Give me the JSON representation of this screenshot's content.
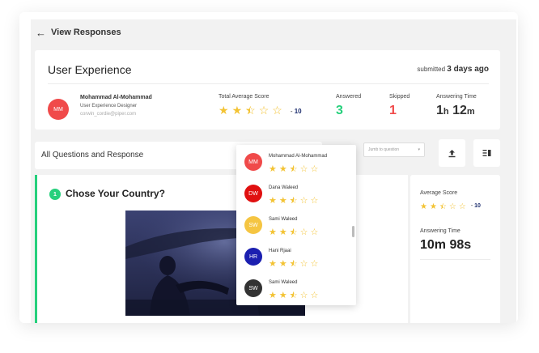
{
  "header": {
    "back_icon": "arrow-left-icon",
    "title": "View Responses"
  },
  "response": {
    "title": "User Experience",
    "submitted_label": "submitted",
    "submitted_value": "3 days ago",
    "user": {
      "initials": "MM",
      "avatar_color": "#f04a4a",
      "name": "Mohammad Al-Mohammad",
      "role": "User Experience Designer",
      "email": "corwin_cordie@piper.com"
    },
    "total_score": {
      "label": "Total Average Score",
      "stars": 2.5,
      "max": 5,
      "separator": "-",
      "value": "10"
    },
    "answered": {
      "label": "Answered",
      "value": "3",
      "color": "#26d07c"
    },
    "skipped": {
      "label": "Skipped",
      "value": "1",
      "color": "#f04a4a"
    },
    "answering_time": {
      "label": "Answering Time",
      "hours": "1",
      "hours_unit": "h",
      "minutes": "12",
      "minutes_unit": "m"
    }
  },
  "questions_bar": {
    "title": "All Questions and Response",
    "jump_placeholder": "Jumb to question",
    "upload_icon": "upload-icon",
    "layout_icon": "column-layout-icon"
  },
  "question": {
    "number": "1",
    "title": "Chose Your Country?",
    "average_label": "Average Score",
    "average_stars": 2.5,
    "average_value": "10",
    "time_label": "Answering Time",
    "time_value": "10m 98s"
  },
  "respondents": [
    {
      "initials": "MM",
      "name": "Mohammad Al-Mohammad",
      "color": "#f04a4a",
      "stars": 2.5
    },
    {
      "initials": "DW",
      "name": "Dana Waleed",
      "color": "#e01010",
      "stars": 2.5
    },
    {
      "initials": "SW",
      "name": "Sami Waleed",
      "color": "#f5c542",
      "stars": 2.5
    },
    {
      "initials": "HR",
      "name": "Hani Rjaai",
      "color": "#1b1fb0",
      "stars": 2.5
    },
    {
      "initials": "SW",
      "name": "Sami Waleed",
      "color": "#333333",
      "stars": 2.5
    }
  ]
}
